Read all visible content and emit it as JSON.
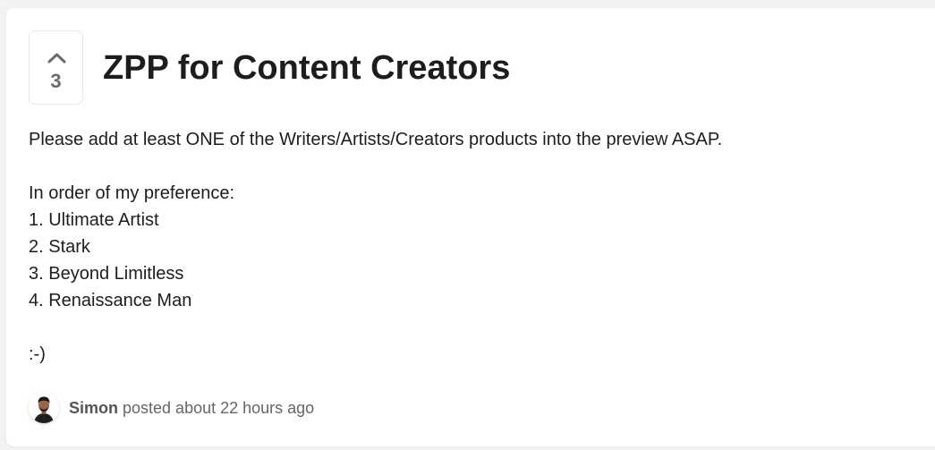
{
  "post": {
    "vote_count": "3",
    "title": "ZPP for Content Creators",
    "body_lines": [
      "Please add at least ONE of the Writers/Artists/Creators products into the preview ASAP.",
      "",
      "In order of my preference:",
      "1. Ultimate Artist",
      "2. Stark",
      "3. Beyond Limitless",
      "4. Renaissance Man",
      "",
      ":-)"
    ],
    "author": "Simon",
    "meta_text": "posted about 22 hours ago"
  },
  "icons": {
    "upvote": "chevron-up-icon",
    "avatar": "user-avatar-photo"
  },
  "colors": {
    "background": "#f4f3f1",
    "card": "#ffffff",
    "text": "#1d1d1d",
    "muted": "#6b6b6b"
  }
}
